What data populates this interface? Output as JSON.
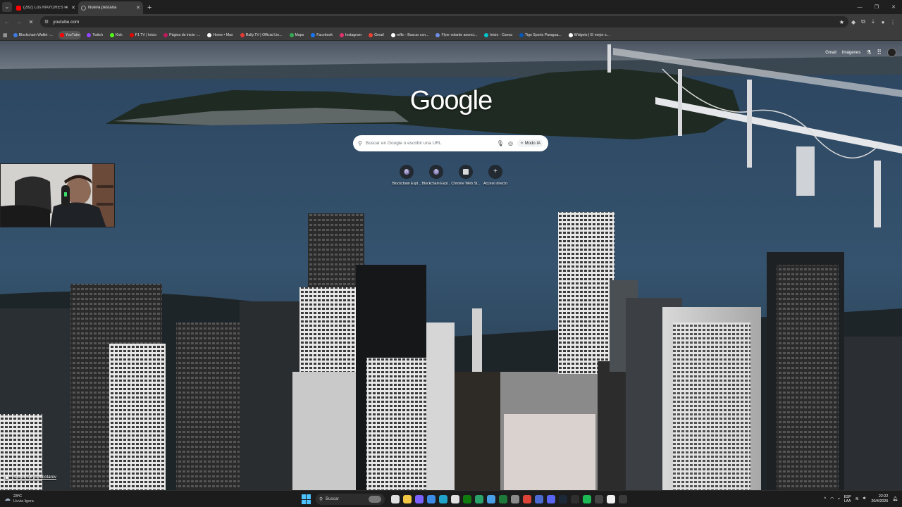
{
  "tabs": [
    {
      "title": "(282) Los MAYORES ENFAD",
      "favicon_color": "#ff0000",
      "audio": true,
      "active": false
    },
    {
      "title": "Nueva pestaña",
      "favicon_color": "#9aa0a6",
      "audio": false,
      "active": true
    }
  ],
  "toolbar": {
    "url": "youtube.com"
  },
  "bookmarks": [
    {
      "label": "Blockchain Wallet -...",
      "color": "#3f7be0",
      "selected": false
    },
    {
      "label": "YouTube",
      "color": "#ff0000",
      "selected": true
    },
    {
      "label": "Twitch",
      "color": "#9146ff",
      "selected": false
    },
    {
      "label": "Kick",
      "color": "#53fc18",
      "selected": false
    },
    {
      "label": "F1 TV | Inicio",
      "color": "#e10600",
      "selected": false
    },
    {
      "label": "Página de inicio -...",
      "color": "#c2185b",
      "selected": false
    },
    {
      "label": "Home • Max",
      "color": "#ffffff",
      "selected": false
    },
    {
      "label": "Rally.TV | Official Lin...",
      "color": "#e53935",
      "selected": false
    },
    {
      "label": "Maps",
      "color": "#34a853",
      "selected": false
    },
    {
      "label": "Facebook",
      "color": "#1877f2",
      "selected": false
    },
    {
      "label": "Instagram",
      "color": "#e1306c",
      "selected": false
    },
    {
      "label": "Gmail",
      "color": "#ea4335",
      "selected": false
    },
    {
      "label": "reflic - Buscar con...",
      "color": "#ffffff",
      "selected": false
    },
    {
      "label": "Flyer volante anunci...",
      "color": "#6c8ee6",
      "selected": false
    },
    {
      "label": "Inicio - Canva",
      "color": "#00c4cc",
      "selected": false
    },
    {
      "label": "Tigo Sports Paragua...",
      "color": "#0057b8",
      "selected": false
    },
    {
      "label": "Widgets | El mejor s...",
      "color": "#ffffff",
      "selected": false
    }
  ],
  "ntp": {
    "top_links": {
      "gmail": "Gmail",
      "images": "Imágenes"
    },
    "logo": "Google",
    "search_placeholder": "Buscar en Google o escribir una URL",
    "ai_mode": "Modo IA",
    "shortcuts": [
      {
        "label": "Blockchain Expl...",
        "icon": "blockchain-icon"
      },
      {
        "label": "Blockchain Expl...",
        "icon": "blockchain-icon"
      },
      {
        "label": "Chrome Web St...",
        "icon": "store-icon"
      },
      {
        "label": "Acceso directo",
        "icon": "plus-icon"
      }
    ],
    "credit": "Foto de Ev Tchebotarev"
  },
  "taskbar": {
    "weather_temp": "23°C",
    "weather_desc": "Lluvia ligera",
    "search_label": "Buscar",
    "lang_top": "ESP",
    "lang_bottom": "LAA",
    "time": "22:22",
    "date": "20/4/2026"
  },
  "colors": {
    "accent": "#4cc2ff",
    "taskbar_bg": "#1c1c1c",
    "tab_bg": "#1f1f1f",
    "toolbar_bg": "#3c3c3c"
  }
}
